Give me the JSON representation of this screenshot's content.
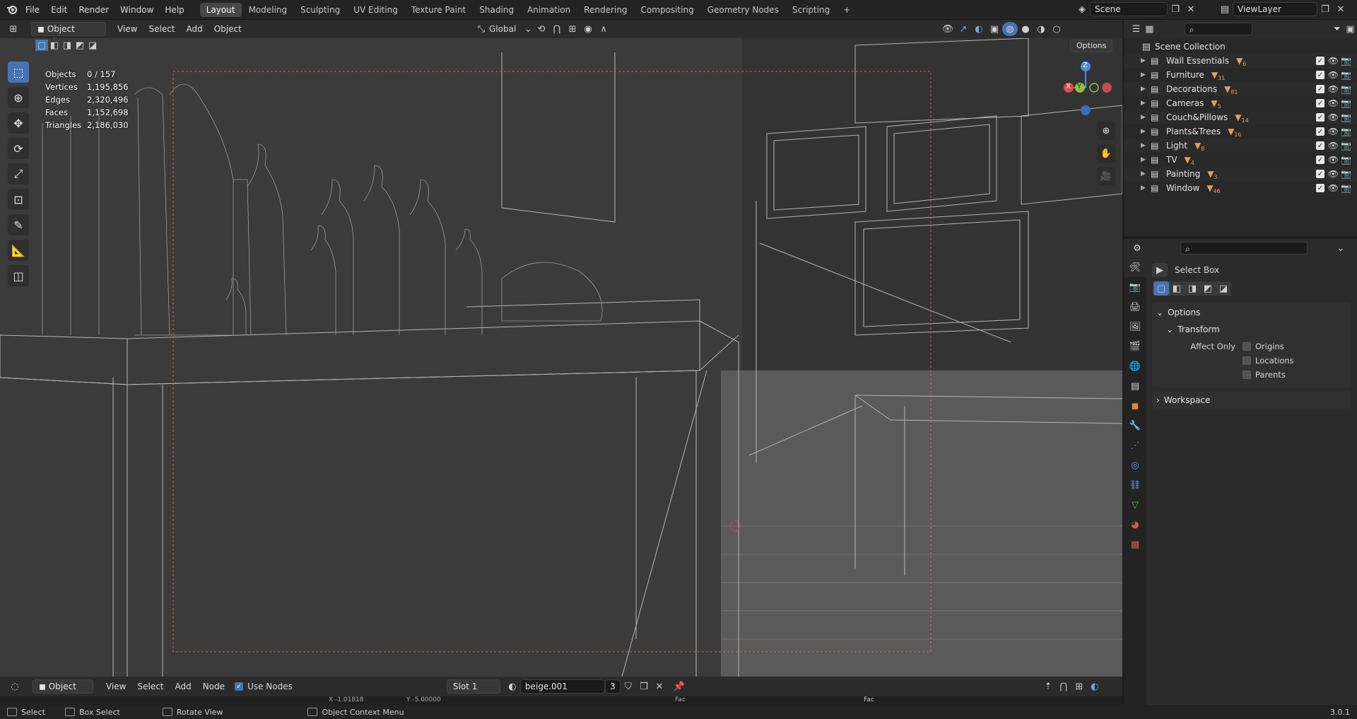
{
  "menubar": {
    "items": [
      "File",
      "Edit",
      "Render",
      "Window",
      "Help"
    ],
    "workspaces": [
      "Layout",
      "Modeling",
      "Sculpting",
      "UV Editing",
      "Texture Paint",
      "Shading",
      "Animation",
      "Rendering",
      "Compositing",
      "Geometry Nodes",
      "Scripting"
    ],
    "add_tab": "+",
    "scene": "Scene",
    "view_layer": "ViewLayer"
  },
  "viewport_header": {
    "mode": "Object Mode",
    "menus": [
      "View",
      "Select",
      "Add",
      "Object"
    ],
    "orientation": "Global",
    "options": "Options"
  },
  "stats": [
    {
      "label": "Objects",
      "value": "0 / 157"
    },
    {
      "label": "Vertices",
      "value": "1,195,856"
    },
    {
      "label": "Edges",
      "value": "2,320,496"
    },
    {
      "label": "Faces",
      "value": "1,152,698"
    },
    {
      "label": "Triangles",
      "value": "2,186,030"
    }
  ],
  "gizmo": {
    "x": "X",
    "y": "Y",
    "z": "Z"
  },
  "outliner": {
    "root": "Scene Collection",
    "collections": [
      {
        "name": "Wall Essentials",
        "count": "6"
      },
      {
        "name": "Furniture",
        "count": "31"
      },
      {
        "name": "Decorations",
        "count": "81"
      },
      {
        "name": "Cameras",
        "count": "5"
      },
      {
        "name": "Couch&Pillows",
        "count": "14"
      },
      {
        "name": "Plants&Trees",
        "count": "16"
      },
      {
        "name": "Light",
        "count": "8"
      },
      {
        "name": "TV",
        "count": "4"
      },
      {
        "name": "Painting",
        "count": "3"
      },
      {
        "name": "Window",
        "count": "46"
      }
    ]
  },
  "properties": {
    "tool_name": "Select Box",
    "options_panel": "Options",
    "transform_panel": "Transform",
    "affect_only": "Affect Only",
    "checks": [
      "Origins",
      "Locations",
      "Parents"
    ],
    "workspace_panel": "Workspace"
  },
  "node_header": {
    "type": "Object",
    "menus": [
      "View",
      "Select",
      "Add",
      "Node"
    ],
    "use_nodes": "Use Nodes",
    "slot": "Slot 1",
    "material": "beige.001",
    "users": "3",
    "hint_x": "X -1.01818",
    "hint_y": "Y -5.00000",
    "node_fac_a": "Fac",
    "node_fac_b": "Fac"
  },
  "statusbar": {
    "select": "Select",
    "box_select": "Box Select",
    "rotate_view": "Rotate View",
    "context_menu": "Object Context Menu",
    "version": "3.0.1"
  },
  "colors": {
    "accent": "#4772b3",
    "collection_icon": "#e0a060",
    "x_axis": "#e24a4a",
    "y_axis": "#8ac43e",
    "z_axis": "#4a8ae2"
  }
}
